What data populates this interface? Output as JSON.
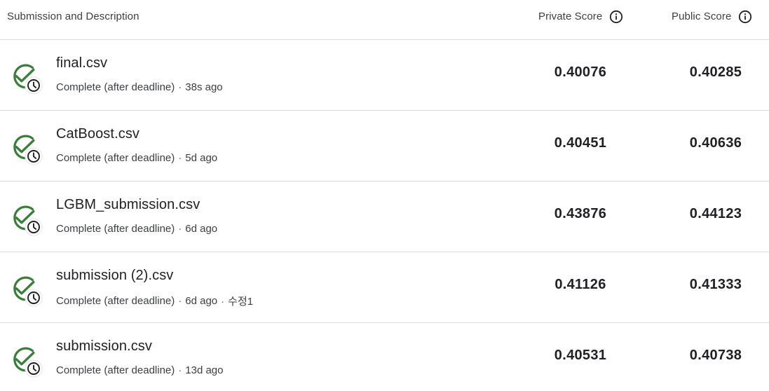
{
  "header": {
    "description_label": "Submission and Description",
    "private_score_label": "Private Score",
    "public_score_label": "Public Score"
  },
  "colors": {
    "success_green": "#3b7d3a",
    "text_primary": "#202124",
    "text_secondary": "#3c4043",
    "divider": "#dadce0"
  },
  "submissions": [
    {
      "name": "final.csv",
      "status": "Complete (after deadline)",
      "age": "38s ago",
      "edited": "",
      "private_score": "0.40076",
      "public_score": "0.40285"
    },
    {
      "name": "CatBoost.csv",
      "status": "Complete (after deadline)",
      "age": "5d ago",
      "edited": "",
      "private_score": "0.40451",
      "public_score": "0.40636"
    },
    {
      "name": "LGBM_submission.csv",
      "status": "Complete (after deadline)",
      "age": "6d ago",
      "edited": "",
      "private_score": "0.43876",
      "public_score": "0.44123"
    },
    {
      "name": "submission (2).csv",
      "status": "Complete (after deadline)",
      "age": "6d ago",
      "edited": "수정1",
      "private_score": "0.41126",
      "public_score": "0.41333"
    },
    {
      "name": "submission.csv",
      "status": "Complete (after deadline)",
      "age": "13d ago",
      "edited": "",
      "private_score": "0.40531",
      "public_score": "0.40738"
    }
  ],
  "icons": {
    "status": "check-clock-icon",
    "info": "info-icon"
  }
}
